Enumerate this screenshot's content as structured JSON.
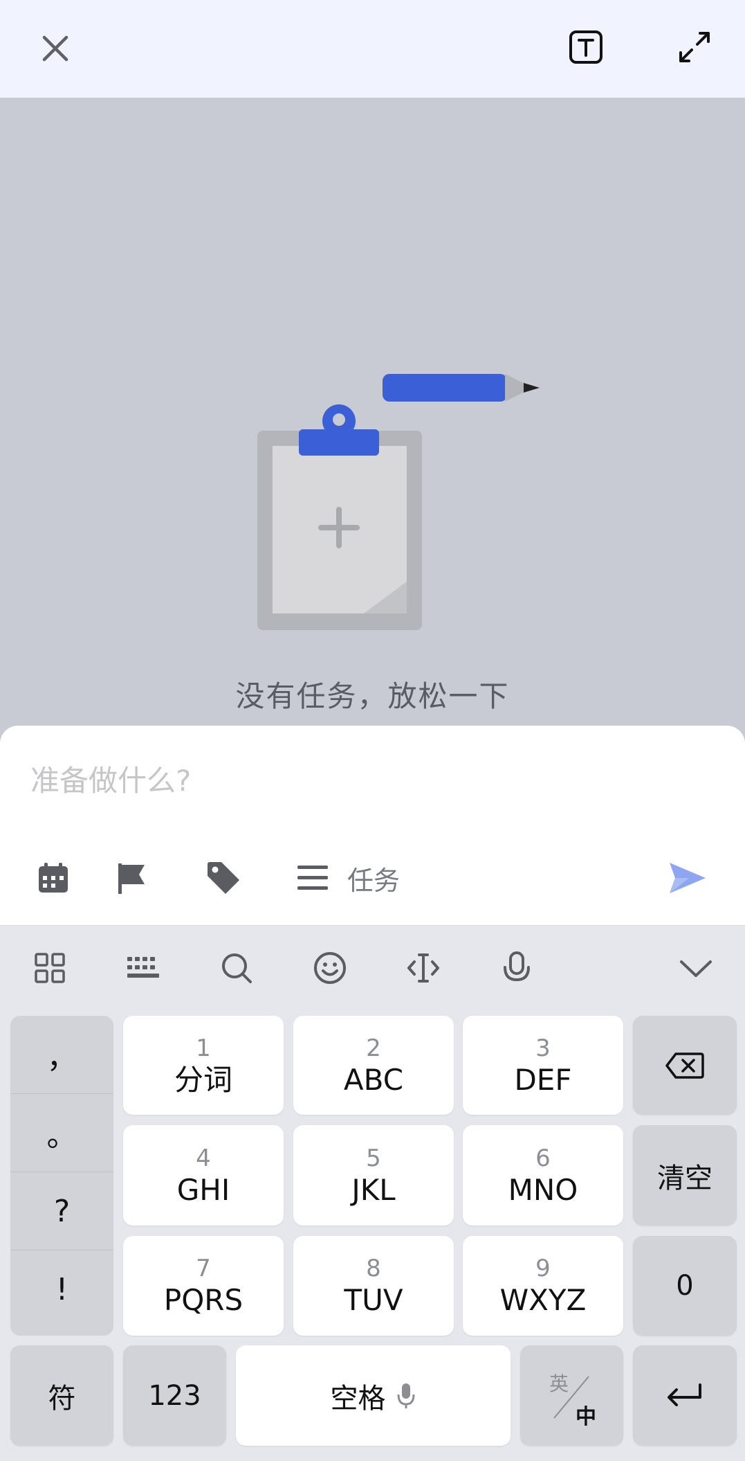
{
  "top_bar": {
    "close_icon": "close-icon",
    "text_mode_icon": "text-box-icon",
    "expand_icon": "expand-icon"
  },
  "empty_state": {
    "illustration": "clipboard-pencil-illustration",
    "message": "没有任务，放松一下"
  },
  "composer": {
    "placeholder": "准备做什么?",
    "tools": [
      "calendar-icon",
      "flag-icon",
      "tag-icon"
    ],
    "list_icon": "menu-lines-icon",
    "list_label": "任务",
    "send_icon": "send-icon",
    "accent_color": "#3b5fd6",
    "send_color": "#8ea6f2"
  },
  "keyboard": {
    "toolbar": [
      "grid-icon",
      "keyboard-icon",
      "search-icon",
      "emoji-icon",
      "cursor-icon",
      "microphone-icon",
      "chevron-down-icon"
    ],
    "punctuation": [
      "，",
      "。",
      "?",
      "!"
    ],
    "keys": [
      {
        "num": "1",
        "letters": "分词"
      },
      {
        "num": "2",
        "letters": "ABC"
      },
      {
        "num": "3",
        "letters": "DEF"
      },
      {
        "num": "4",
        "letters": "GHI"
      },
      {
        "num": "5",
        "letters": "JKL"
      },
      {
        "num": "6",
        "letters": "MNO"
      },
      {
        "num": "7",
        "letters": "PQRS"
      },
      {
        "num": "8",
        "letters": "TUV"
      },
      {
        "num": "9",
        "letters": "WXYZ"
      }
    ],
    "backspace_icon": "backspace-icon",
    "clear_label": "清空",
    "zero_label": "0",
    "symbol_label": "符",
    "numeric_label": "123",
    "space_label": "空格",
    "space_mic_icon": "microphone-icon",
    "lang_en": "英",
    "lang_zh": "中",
    "enter_icon": "enter-icon"
  }
}
